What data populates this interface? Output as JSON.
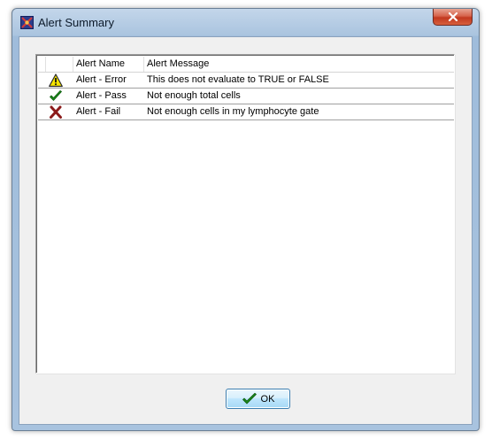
{
  "window": {
    "title": "Alert Summary",
    "close_symbol": "×"
  },
  "table": {
    "columns": [
      "",
      "Alert Name",
      "Alert Message"
    ],
    "rows": [
      {
        "icon": "warning-icon",
        "name": "Alert - Error",
        "message": "This does not evaluate to TRUE or FALSE"
      },
      {
        "icon": "check-icon",
        "name": "Alert - Pass",
        "message": "Not enough total cells"
      },
      {
        "icon": "x-icon",
        "name": "Alert - Fail",
        "message": "Not enough cells in my lymphocyte gate"
      }
    ]
  },
  "footer": {
    "ok_label": "OK",
    "ok_icon": "check-icon"
  },
  "colors": {
    "warning": "#f5e400",
    "pass": "#1c8a1c",
    "fail": "#8b1a1a"
  }
}
